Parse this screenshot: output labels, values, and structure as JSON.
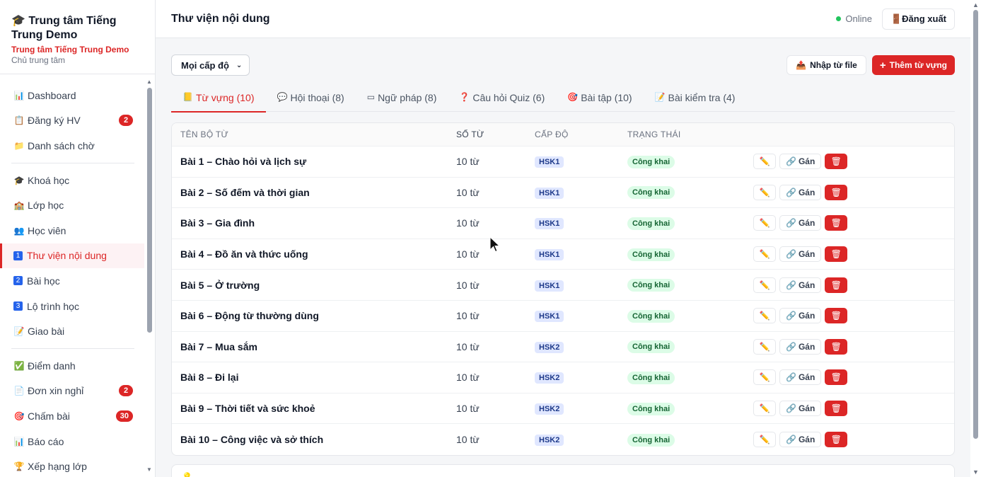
{
  "sidebar": {
    "brand_title": "Trung tâm Tiếng Trung Demo",
    "brand_subtitle": "Trung tâm Tiếng Trung Demo",
    "brand_role": "Chủ trung tâm",
    "items": [
      {
        "icon": "📊",
        "label": "Dashboard",
        "badge": ""
      },
      {
        "icon": "📋",
        "label": "Đăng ký HV",
        "badge": "2"
      },
      {
        "icon": "📁",
        "label": "Danh sách chờ",
        "badge": ""
      },
      {
        "icon": "🎓",
        "label": "Khoá học",
        "badge": ""
      },
      {
        "icon": "🏫",
        "label": "Lớp học",
        "badge": ""
      },
      {
        "icon": "👥",
        "label": "Học viên",
        "badge": ""
      },
      {
        "icon": "1",
        "label": "Thư viện nội dung",
        "badge": ""
      },
      {
        "icon": "2",
        "label": "Bài học",
        "badge": ""
      },
      {
        "icon": "3",
        "label": "Lộ trình học",
        "badge": ""
      },
      {
        "icon": "📝",
        "label": "Giao bài",
        "badge": ""
      },
      {
        "icon": "✅",
        "label": "Điểm danh",
        "badge": ""
      },
      {
        "icon": "📄",
        "label": "Đơn xin nghỉ",
        "badge": "2"
      },
      {
        "icon": "🎯",
        "label": "Chấm bài",
        "badge": "30"
      },
      {
        "icon": "📊",
        "label": "Báo cáo",
        "badge": ""
      },
      {
        "icon": "🏆",
        "label": "Xếp hạng lớp",
        "badge": ""
      }
    ]
  },
  "header": {
    "title": "Thư viện nội dung",
    "status": "Online",
    "logout_label": "Đăng xuất"
  },
  "toolbar": {
    "level_select": "Mọi cấp độ",
    "import_label": "Nhập từ file",
    "add_label": "Thêm từ vựng"
  },
  "tabs": [
    {
      "icon": "📒",
      "label": "Từ vựng (10)"
    },
    {
      "icon": "💬",
      "label": "Hội thoại (8)"
    },
    {
      "icon": "▭",
      "label": "Ngữ pháp (8)"
    },
    {
      "icon": "❓",
      "label": "Câu hỏi Quiz (6)"
    },
    {
      "icon": "🎯",
      "label": "Bài tập (10)"
    },
    {
      "icon": "📝",
      "label": "Bài kiểm tra (4)"
    }
  ],
  "table": {
    "headers": {
      "name": "TÊN BỘ TỪ",
      "count": "SỐ TỪ",
      "level": "CẤP ĐỘ",
      "status": "TRẠNG THÁI"
    },
    "assign_label": "Gán",
    "rows": [
      {
        "name": "Bài 1 – Chào hỏi và lịch sự",
        "count": "10 từ",
        "level": "HSK1",
        "status": "Công khai"
      },
      {
        "name": "Bài 2 – Số đếm và thời gian",
        "count": "10 từ",
        "level": "HSK1",
        "status": "Công khai"
      },
      {
        "name": "Bài 3 – Gia đình",
        "count": "10 từ",
        "level": "HSK1",
        "status": "Công khai"
      },
      {
        "name": "Bài 4 – Đồ ăn và thức uống",
        "count": "10 từ",
        "level": "HSK1",
        "status": "Công khai"
      },
      {
        "name": "Bài 5 – Ở trường",
        "count": "10 từ",
        "level": "HSK1",
        "status": "Công khai"
      },
      {
        "name": "Bài 6 – Động từ thường dùng",
        "count": "10 từ",
        "level": "HSK1",
        "status": "Công khai"
      },
      {
        "name": "Bài 7 – Mua sắm",
        "count": "10 từ",
        "level": "HSK2",
        "status": "Công khai"
      },
      {
        "name": "Bài 8 – Đi lại",
        "count": "10 từ",
        "level": "HSK2",
        "status": "Công khai"
      },
      {
        "name": "Bài 9 – Thời tiết và sức khoẻ",
        "count": "10 từ",
        "level": "HSK2",
        "status": "Công khai"
      },
      {
        "name": "Bài 10 – Công việc và sở thích",
        "count": "10 từ",
        "level": "HSK2",
        "status": "Công khai"
      }
    ]
  },
  "colors": {
    "accent": "#dc2626",
    "success": "#22c55e"
  }
}
